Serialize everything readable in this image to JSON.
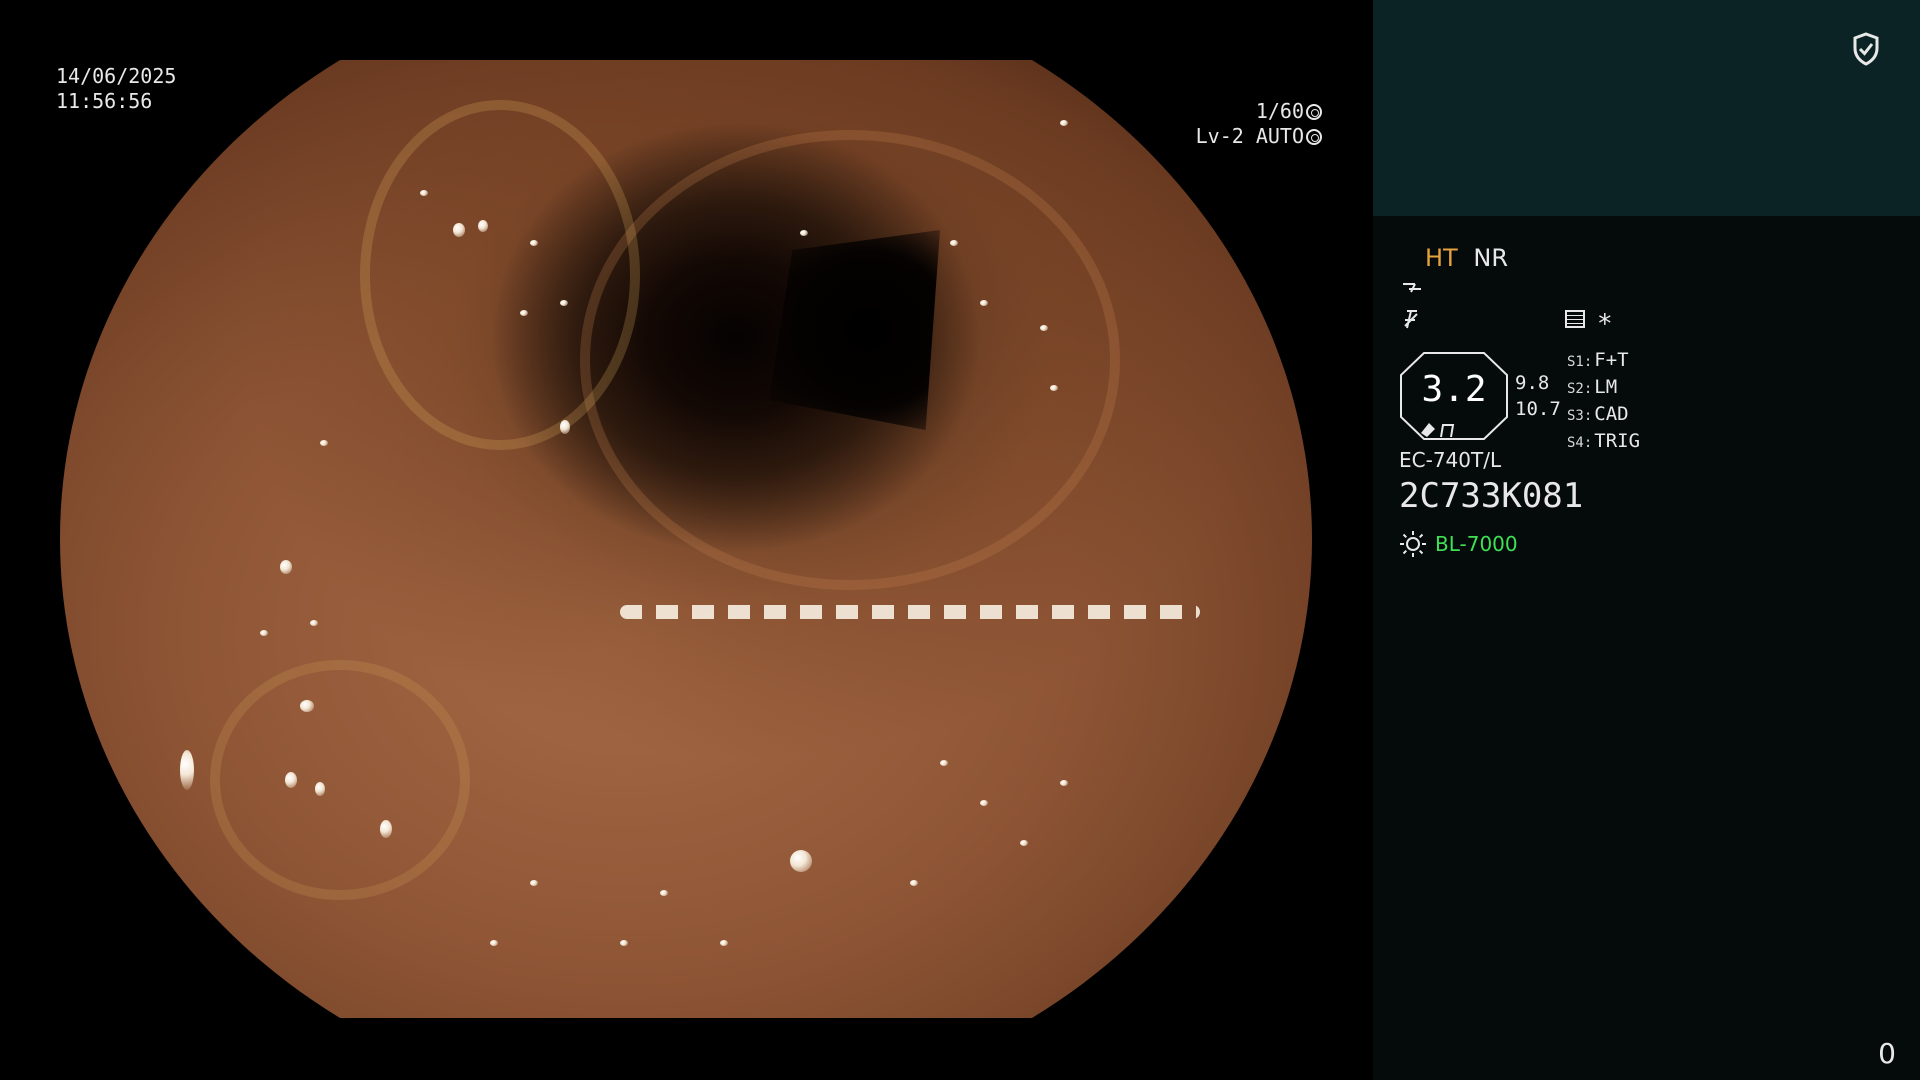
{
  "video": {
    "date": "14/06/2025",
    "time": "11:56:56",
    "shutter": "1/60",
    "iris": "Lv-2 AUTO"
  },
  "panel": {
    "mode_ht": "HT",
    "mode_nr": "NR",
    "enhancement_value": "3.2",
    "side_value_1": "9.8",
    "side_value_2": "10.7",
    "switches": [
      {
        "key": "S1:",
        "label": "F+T"
      },
      {
        "key": "S2:",
        "label": "LM"
      },
      {
        "key": "S3:",
        "label": "CAD"
      },
      {
        "key": "S4:",
        "label": "TRIG"
      }
    ],
    "scope_model": "EC-740T/L",
    "scope_serial": "2C733K081",
    "light_source": "BL-7000",
    "counter": "0"
  },
  "icons": {
    "shield": "shield-check-icon",
    "sun": "light-source-icon",
    "list": "menu-list-icon"
  },
  "colors": {
    "ht_accent": "#e6a23c",
    "light_source_accent": "#3ee054",
    "panel_top": "#0b2325",
    "panel_body": "#050b0b"
  }
}
